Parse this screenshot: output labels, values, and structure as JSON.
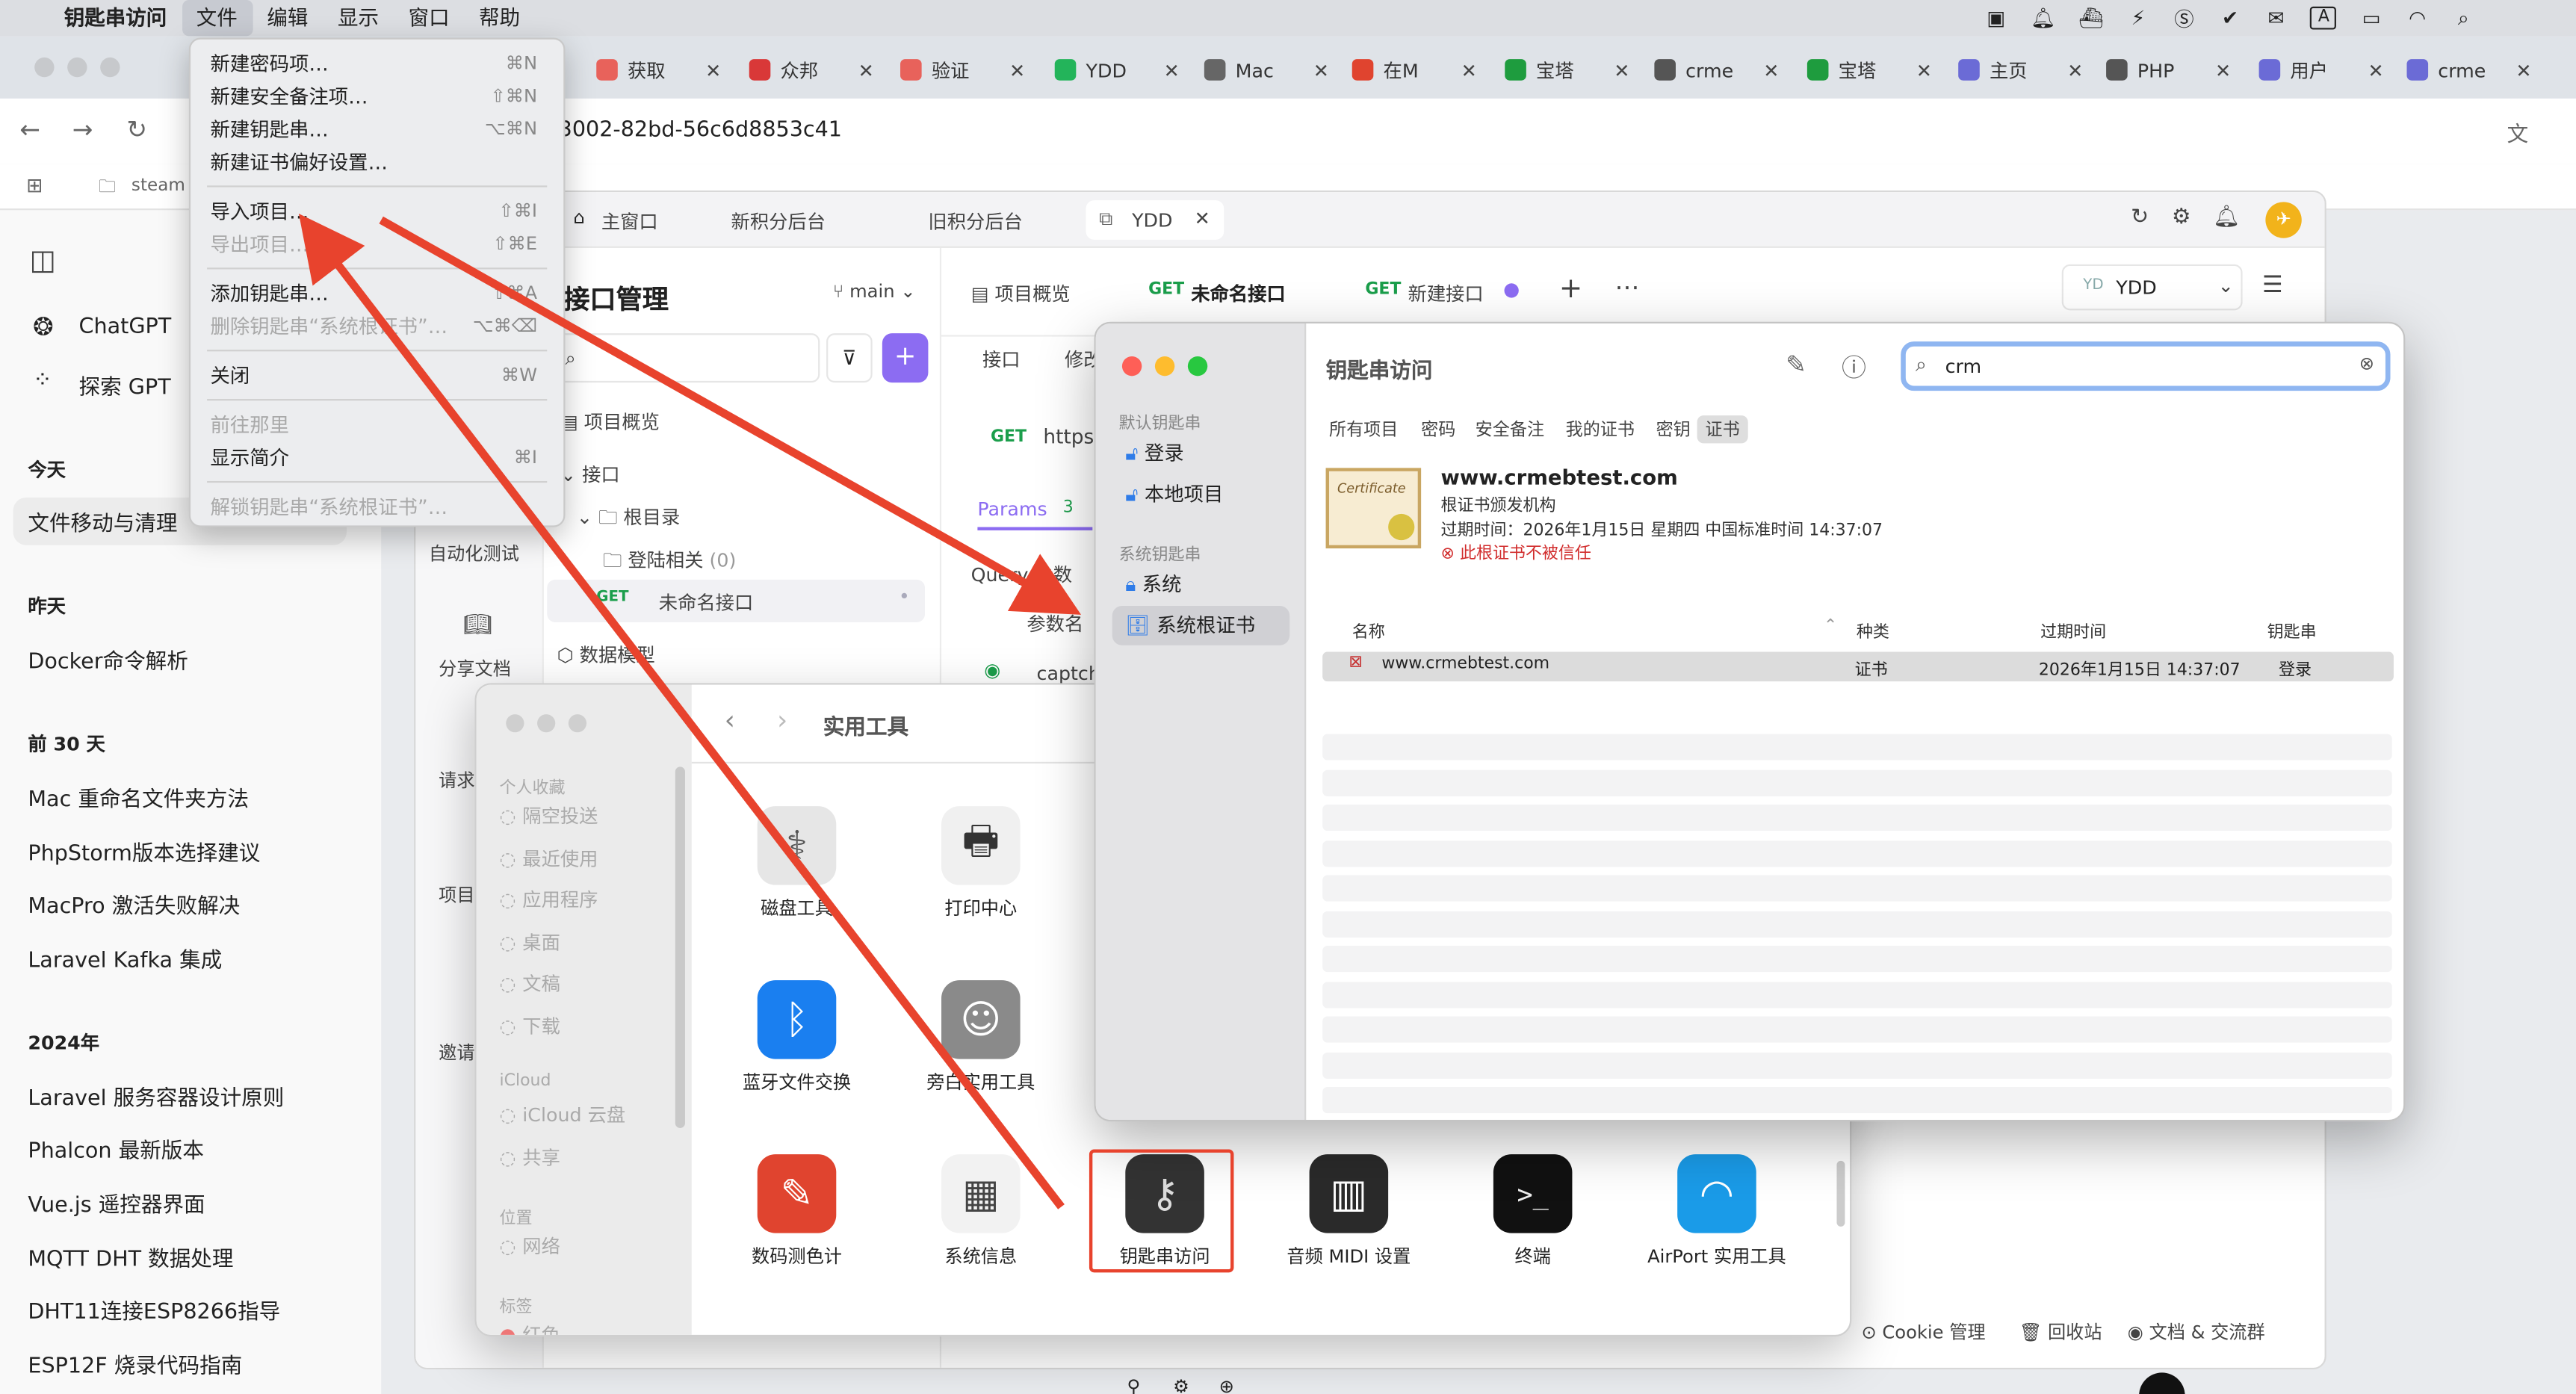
{
  "menubar": {
    "app": "钥匙串访问",
    "items": [
      "文件",
      "编辑",
      "显示",
      "窗口",
      "帮助"
    ],
    "input_method": "A"
  },
  "browser": {
    "tabs": [
      {
        "label": "获取",
        "color": "#e8625b"
      },
      {
        "label": "众邦",
        "color": "#d93838"
      },
      {
        "label": "验证",
        "color": "#e8625b"
      },
      {
        "label": "YDD",
        "color": "#23b45a"
      },
      {
        "label": "Mac",
        "color": "#666"
      },
      {
        "label": "在M",
        "color": "#e0442f"
      },
      {
        "label": "宝塔",
        "color": "#1e9c3e"
      },
      {
        "label": "crme",
        "color": "#555"
      },
      {
        "label": "宝塔",
        "color": "#1e9c3e"
      },
      {
        "label": "主页",
        "color": "#6b6bd6"
      },
      {
        "label": "PHP",
        "color": "#555"
      },
      {
        "label": "用户",
        "color": "#6b6bd6"
      },
      {
        "label": "crme",
        "color": "#6b6bd6"
      }
    ],
    "url": "3002-82bd-56c6d8853c41",
    "bookmark_first": "steam"
  },
  "gpt": {
    "items": [
      "ChatGPT",
      "探索 GPT"
    ],
    "groups": [
      {
        "label": "今天",
        "items": [
          "文件移动与清理"
        ]
      },
      {
        "label": "昨天",
        "items": [
          "Docker命令解析"
        ]
      },
      {
        "label": "前 30 天",
        "items": [
          "Mac 重命名文件夹方法",
          "PhpStorm版本选择建议",
          "MacPro 激活失败解决",
          "Laravel Kafka 集成"
        ]
      },
      {
        "label": "2024年",
        "items": [
          "Laravel 服务容器设计原则",
          "Phalcon 最新版本",
          "Vue.js 遥控器界面",
          "MQTT DHT 数据处理",
          "DHT11连接ESP8266指导",
          "ESP12F 烧录代码指南"
        ]
      }
    ]
  },
  "apifox": {
    "top_tabs": [
      "主窗口",
      "新积分后台",
      "旧积分后台",
      "YDD"
    ],
    "sidebar_title": "接口管理",
    "branch": "main",
    "nav": [
      "自动化测试",
      "分享文档",
      "请求",
      "项目",
      "邀请"
    ],
    "tree": [
      "项目概览",
      "接口",
      "根目录",
      "登陆相关",
      "(0)",
      "未命名接口",
      "数据模型"
    ],
    "req_tabs": [
      "项目概览",
      "未命名接口",
      "新建接口"
    ],
    "method": "GET",
    "env": "YDD",
    "sub_tabs": [
      "接口",
      "修改"
    ],
    "url_prefix": "https:",
    "params_label": "Params",
    "params_count": "3",
    "query_label": "Query 参数",
    "param_name_label": "参数名",
    "param_row": "captch",
    "footer": [
      "Cookie 管理",
      "回收站",
      "文档 & 交流群"
    ]
  },
  "file_menu": {
    "rows": [
      {
        "label": "新建密码项…",
        "shortcut": "⌘N",
        "disabled": false
      },
      {
        "label": "新建安全备注项…",
        "shortcut": "⇧⌘N",
        "disabled": false
      },
      {
        "label": "新建钥匙串…",
        "shortcut": "⌥⌘N",
        "disabled": false
      },
      {
        "label": "新建证书偏好设置…",
        "shortcut": "",
        "disabled": false
      },
      {
        "label": "导入项目…",
        "shortcut": "⇧⌘I",
        "disabled": false
      },
      {
        "label": "导出项目…",
        "shortcut": "⇧⌘E",
        "disabled": true
      },
      {
        "label": "添加钥匙串…",
        "shortcut": "⇧⌘A",
        "disabled": false
      },
      {
        "label": "删除钥匙串“系统根证书”…",
        "shortcut": "⌥⌘⌫",
        "disabled": true
      },
      {
        "label": "关闭",
        "shortcut": "⌘W",
        "disabled": false
      },
      {
        "label": "前往那里",
        "shortcut": "",
        "disabled": true
      },
      {
        "label": "显示简介",
        "shortcut": "⌘I",
        "disabled": false
      },
      {
        "label": "解锁钥匙串“系统根证书”…",
        "shortcut": "",
        "disabled": true
      }
    ]
  },
  "utilities": {
    "title": "实用工具",
    "favorites_label": "个人收藏",
    "favorites": [
      "隔空投送",
      "最近使用",
      "应用程序",
      "桌面",
      "文稿",
      "下载"
    ],
    "icloud_label": "iCloud",
    "icloud": [
      "iCloud 云盘",
      "共享"
    ],
    "locations_label": "位置",
    "locations": [
      "网络"
    ],
    "tags_label": "标签",
    "tags": [
      "红色"
    ],
    "apps": [
      {
        "name": "磁盘工具",
        "icon": "disk-utility-icon",
        "glyph": "⚕",
        "bg": "#e6e6e6",
        "fg": "#555"
      },
      {
        "name": "打印中心",
        "icon": "printer-icon",
        "glyph": "🖶",
        "bg": "#f0f0f0",
        "fg": "#333"
      },
      {
        "name": "蓝牙文件交换",
        "icon": "bluetooth-icon",
        "glyph": "ᛒ",
        "bg": "#1a7ff0",
        "fg": "#fff"
      },
      {
        "name": "旁白实用工具",
        "icon": "voiceover-icon",
        "glyph": "☺",
        "bg": "#8a8a8a",
        "fg": "#fff"
      },
      {
        "name": "数码测色计",
        "icon": "color-meter-icon",
        "glyph": "✎",
        "bg": "#e0442f",
        "fg": "#fff"
      },
      {
        "name": "系统信息",
        "icon": "system-info-icon",
        "glyph": "▦",
        "bg": "#f2f2f2",
        "fg": "#444"
      },
      {
        "name": "钥匙串访问",
        "icon": "keychain-icon",
        "glyph": "⚷",
        "bg": "#333",
        "fg": "#ddd"
      },
      {
        "name": "音频 MIDI 设置",
        "icon": "midi-icon",
        "glyph": "▥",
        "bg": "#2a2a2a",
        "fg": "#fff"
      },
      {
        "name": "终端",
        "icon": "terminal-icon",
        "glyph": ">_",
        "bg": "#111",
        "fg": "#eee"
      },
      {
        "name": "AirPort 实用工具",
        "icon": "airport-icon",
        "glyph": "◠",
        "bg": "#1a9be8",
        "fg": "#fff"
      }
    ]
  },
  "keychain": {
    "title": "钥匙串访问",
    "search_value": "crm",
    "default_group": "默认钥匙串",
    "default_items": [
      "登录",
      "本地项目"
    ],
    "system_group": "系统钥匙串",
    "system_items": [
      "系统",
      "系统根证书"
    ],
    "filter_tabs": [
      "所有项目",
      "密码",
      "安全备注",
      "我的证书",
      "密钥",
      "证书"
    ],
    "cert_badge": "Certificate",
    "cert_name": "www.crmebtest.com",
    "cert_issuer": "根证书颁发机构",
    "cert_expiry": "过期时间：2026年1月15日 星期四 中国标准时间 14:37:07",
    "cert_warning": "此根证书不被信任",
    "columns": [
      "名称",
      "种类",
      "过期时间",
      "钥匙串"
    ],
    "row": {
      "name": "www.crmebtest.com",
      "kind": "证书",
      "expires": "2026年1月15日 14:37:07",
      "keychain": "登录"
    }
  },
  "colors": {
    "arrow": "#e8432d",
    "accent": "#7b5cf0",
    "get": "#1b9e4b"
  }
}
